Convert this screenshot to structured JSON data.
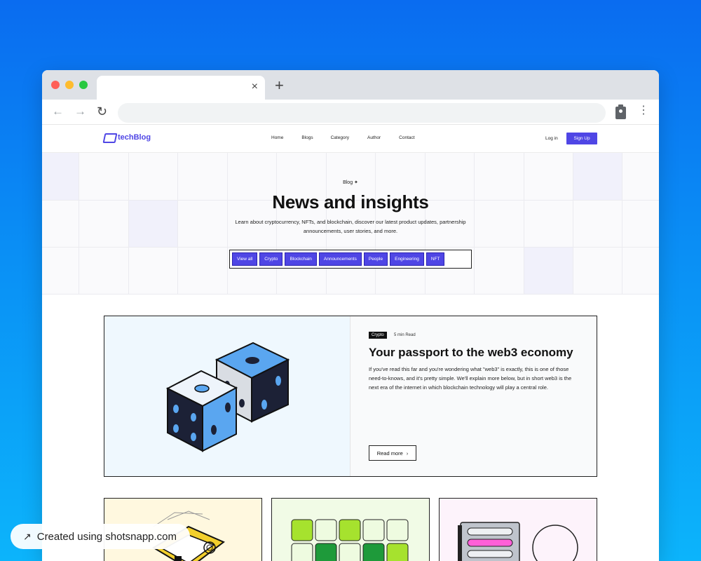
{
  "browser": {
    "tab_close": "×",
    "new_tab": "+",
    "back": "←",
    "forward": "→",
    "reload": "↻",
    "menu": "⋮",
    "address": ""
  },
  "site": {
    "logo": "techBlog",
    "nav": [
      "Home",
      "Blogs",
      "Category",
      "Author",
      "Contact"
    ],
    "login": "Log in",
    "signup": "Sign Up"
  },
  "hero": {
    "crumb": "Blog ✦",
    "title": "News and insights",
    "subtitle": "Learn about cryptocurrency, NFTs, and blockchain, discover our latest product updates, partnership announcements, user stories, and more.",
    "filters": [
      "View all",
      "Crypto",
      "Blockchain",
      "Announcements",
      "People",
      "Engineering",
      "NFT"
    ]
  },
  "featured": {
    "tag": "Crypto",
    "read_time": "5 min Read",
    "title": "Your passport to the web3 economy",
    "text": "If you've read this far and you're wondering what \"web3\" is exactly, this is one of those need-to-knows, and it's pretty simple. We'll explain more below, but in short web3 is the next era of the internet in which blockchain technology will play a central role.",
    "cta": "Read more",
    "cta_arrow": "›"
  },
  "cards": [
    {
      "illustration": "fingerprint-card-illustration"
    },
    {
      "illustration": "green-grid-illustration"
    },
    {
      "illustration": "www-globe-illustration"
    }
  ],
  "badge": {
    "icon": "↗",
    "text": "Created using shotsnapp.com"
  },
  "colors": {
    "accent": "#4f46e5",
    "background_top": "#0a6cf0",
    "background_bottom": "#0cb4fb"
  }
}
